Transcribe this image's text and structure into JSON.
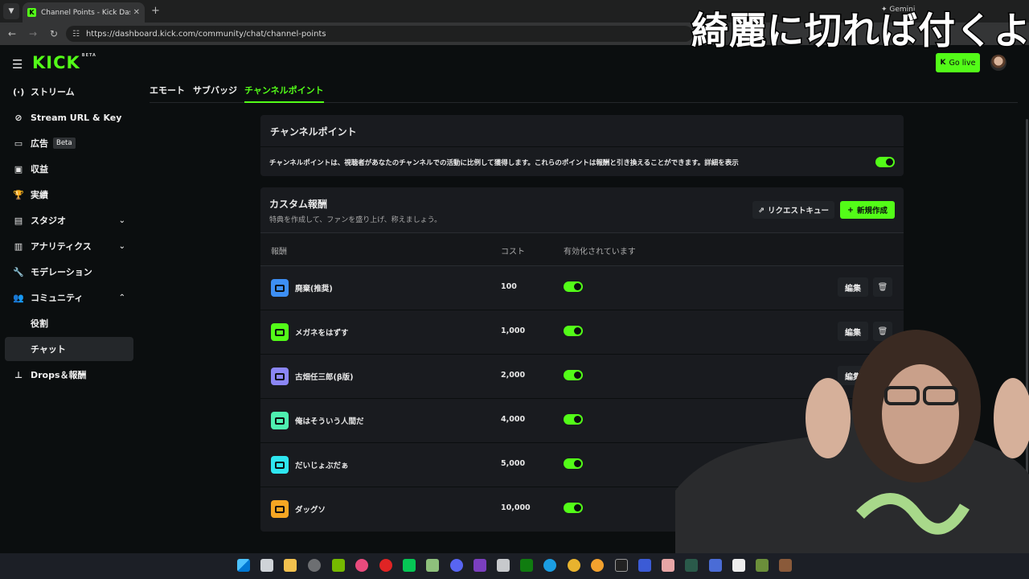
{
  "browser": {
    "tab_title": "Channel Points - Kick Dashboard",
    "tab_favicon": "K",
    "url": "https://dashboard.kick.com/community/chat/channel-points",
    "gemini_label": "Gemini"
  },
  "caption": "綺麗に切れば付くよ",
  "header": {
    "logo": "KICK",
    "logo_badge": "BETA",
    "go_live": "Go live",
    "go_live_icon": "K"
  },
  "sidebar": {
    "items": [
      {
        "label": "ストリーム",
        "icon": "(·)"
      },
      {
        "label": "Stream URL & Key",
        "icon": "⊘"
      },
      {
        "label": "広告",
        "badge": "Beta",
        "icon": "▭"
      },
      {
        "label": "収益",
        "icon": "▣"
      },
      {
        "label": "実績",
        "icon": "🏆"
      },
      {
        "label": "スタジオ",
        "icon": "▤"
      },
      {
        "label": "アナリティクス",
        "icon": "▥"
      },
      {
        "label": "モデレーション",
        "icon": "🔧"
      },
      {
        "label": "コミュニティ",
        "icon": "👥"
      },
      {
        "label": "役割"
      },
      {
        "label": "チャット"
      },
      {
        "label": "Drops＆報酬",
        "icon": "⊥"
      }
    ]
  },
  "tabs": [
    "エモート",
    "サブバッジ",
    "チャンネルポイント"
  ],
  "channel_points": {
    "title": "チャンネルポイント",
    "description": "チャンネルポイントは、視聴者があなたのチャンネルでの活動に比例して獲得します。これらのポイントは報酬と引き換えることができます。詳細を表示",
    "enabled": true
  },
  "custom_rewards": {
    "title": "カスタム報酬",
    "subtitle": "特典を作成して、ファンを盛り上げ、称えましょう。",
    "request_queue": "リクエストキュー",
    "new_button": "新規作成",
    "columns": {
      "reward": "報酬",
      "cost": "コスト",
      "enabled": "有効化されています"
    },
    "edit_label": "編集",
    "rows": [
      {
        "name": "廃棄(推奨)",
        "cost": "100",
        "color": "#3d8ff5",
        "enabled": true
      },
      {
        "name": "メガネをはずす",
        "cost": "1,000",
        "color": "#53fc18",
        "enabled": true
      },
      {
        "name": "古畑任三郎(β版)",
        "cost": "2,000",
        "color": "#8b86f5",
        "enabled": true
      },
      {
        "name": "俺はそういう人間だ",
        "cost": "4,000",
        "color": "#4ef0b0",
        "enabled": true
      },
      {
        "name": "だいじょぶだぁ",
        "cost": "5,000",
        "color": "#2ee6f0",
        "enabled": true
      },
      {
        "name": "ダッグソ",
        "cost": "10,000",
        "color": "#f5a623",
        "enabled": true
      }
    ]
  },
  "colors": {
    "accent": "#53fc18",
    "background": "#0b0e0f",
    "card": "#191b1f"
  }
}
